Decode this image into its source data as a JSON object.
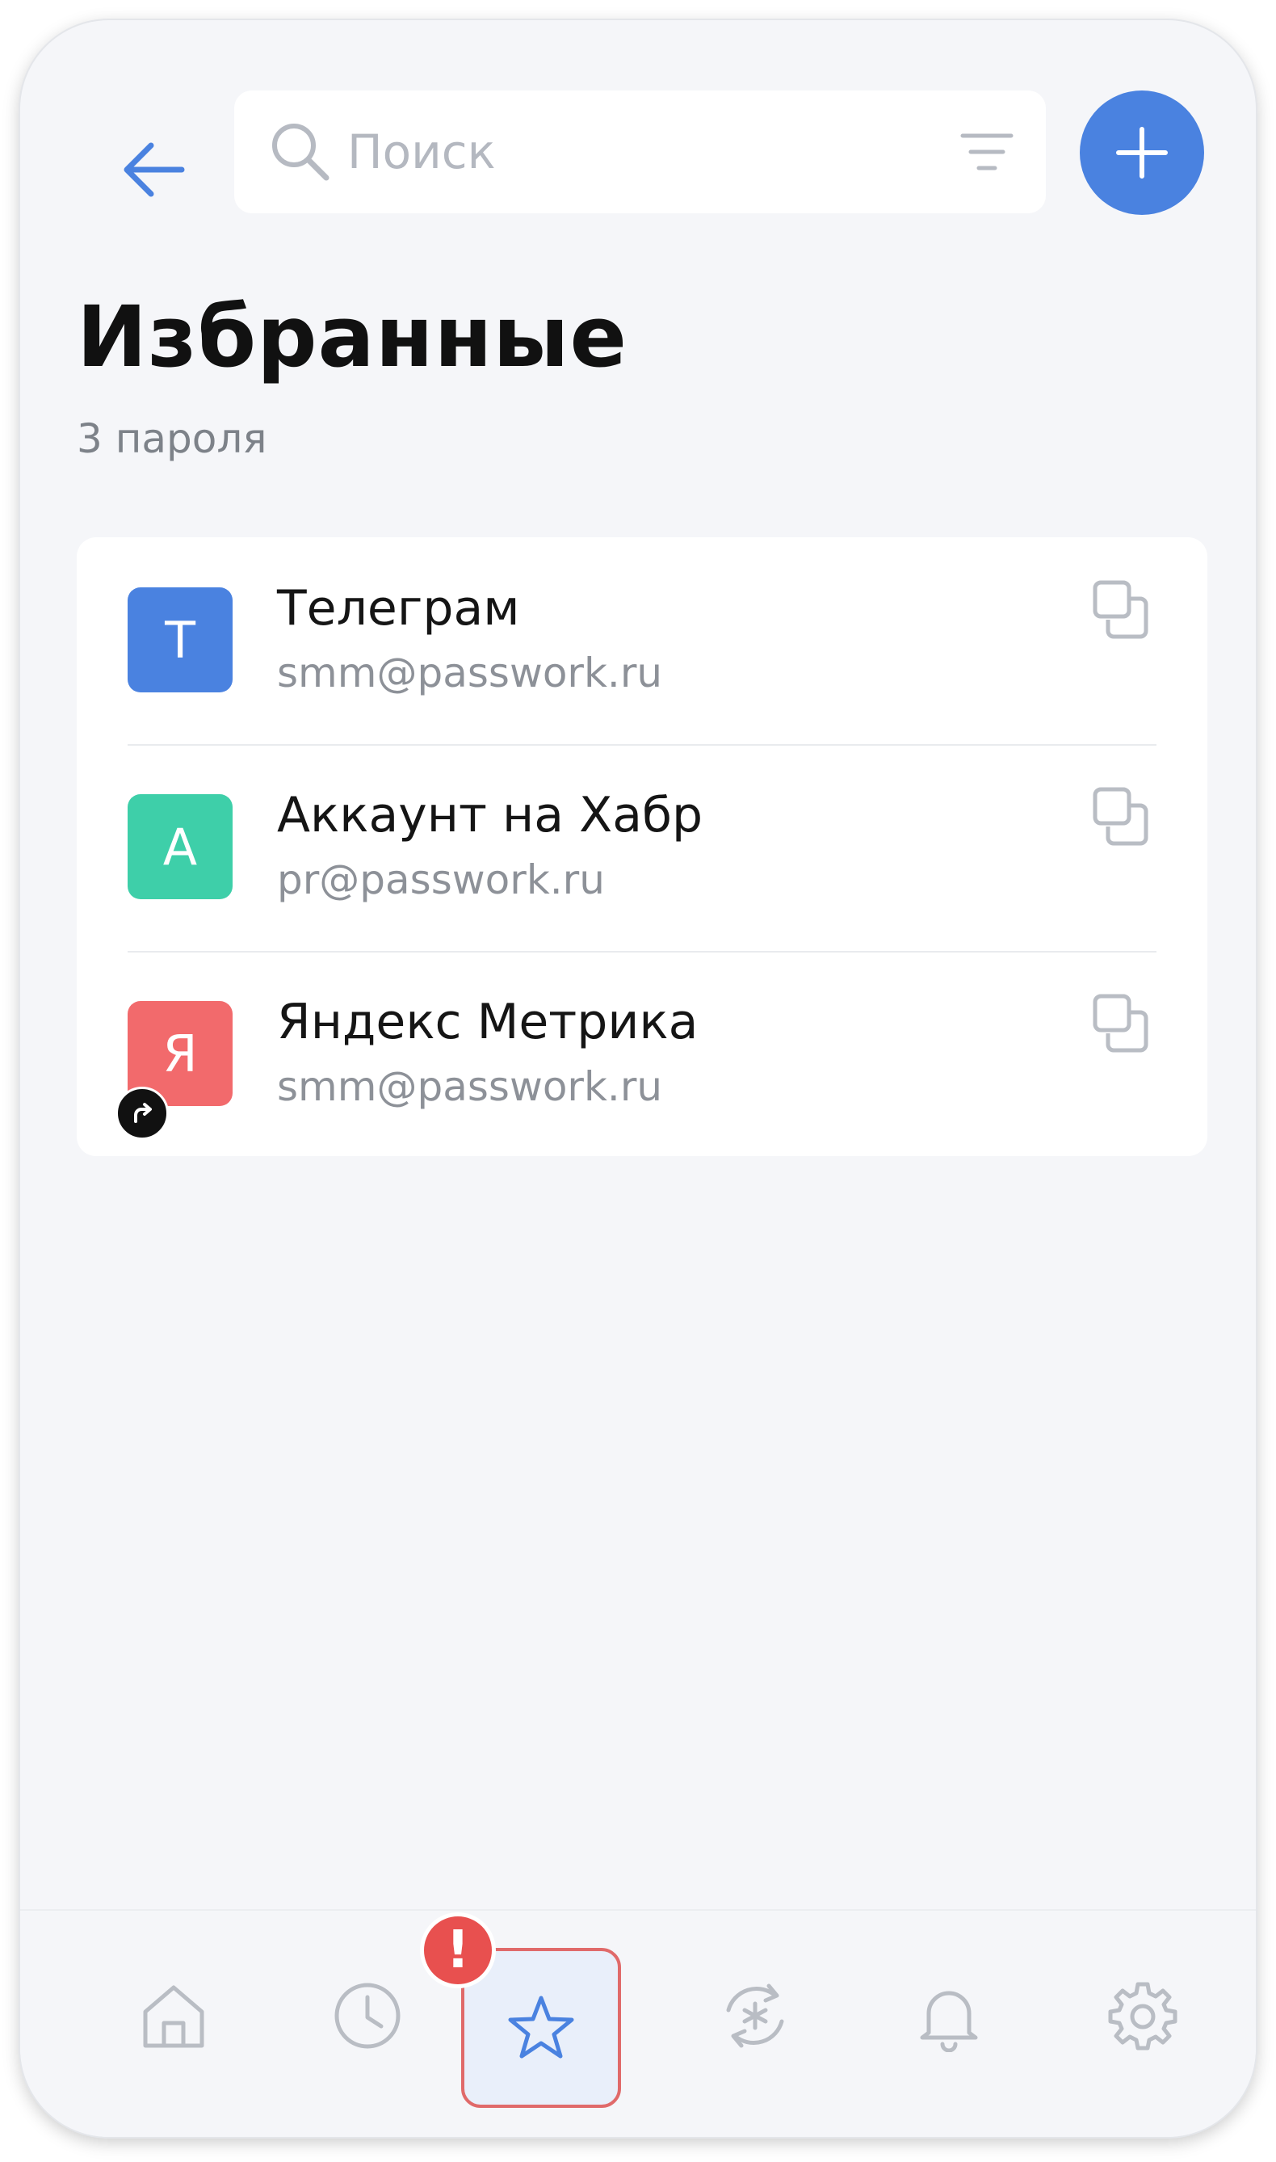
{
  "header": {
    "search": {
      "placeholder": "Поиск",
      "value": ""
    }
  },
  "page": {
    "title": "Избранные",
    "subtitle": "3 пароля"
  },
  "items": [
    {
      "avatar_letter": "Т",
      "avatar_color": "#4a82e0",
      "title": "Телеграм",
      "login": "smm@passwork.ru",
      "shared": false
    },
    {
      "avatar_letter": "А",
      "avatar_color": "#3ecfa9",
      "title": "Аккаунт на Хабр",
      "login": "pr@passwork.ru",
      "shared": false
    },
    {
      "avatar_letter": "Я",
      "avatar_color": "#f26a6c",
      "title": "Яндекс Метрика",
      "login": "smm@passwork.ru",
      "shared": true
    }
  ],
  "bottom_nav": {
    "items": [
      {
        "icon": "home-icon",
        "active": false
      },
      {
        "icon": "clock-icon",
        "active": false
      },
      {
        "icon": "star-icon",
        "active": true
      },
      {
        "icon": "password-generator-icon",
        "active": false
      },
      {
        "icon": "bell-icon",
        "active": false
      },
      {
        "icon": "gear-icon",
        "active": false
      }
    ],
    "alert_badge": "!"
  },
  "colors": {
    "accent": "#4a82e0",
    "background": "#f5f6f9",
    "alert": "#e8504f"
  }
}
